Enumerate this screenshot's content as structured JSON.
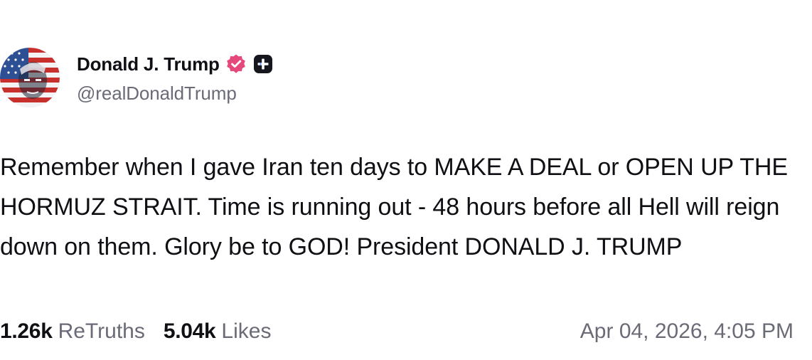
{
  "author": {
    "display_name": "Donald J. Trump",
    "handle": "@realDonaldTrump",
    "verified_icon": "verified-badge-icon",
    "plus_icon": "plus-badge-icon",
    "colors": {
      "verified_badge": "#e5487b",
      "plus_badge": "#16161e"
    }
  },
  "post": {
    "text": "Remember when I gave Iran ten days to MAKE A DEAL or OPEN UP THE HORMUZ STRAIT. Time is running out - 48 hours before all Hell will reign down on them. Glory be to GOD! President DONALD J. TRUMP"
  },
  "stats": {
    "retruths_count": "1.26k",
    "retruths_label": "ReTruths",
    "likes_count": "5.04k",
    "likes_label": "Likes"
  },
  "timestamp": "Apr 04, 2026, 4:05 PM"
}
